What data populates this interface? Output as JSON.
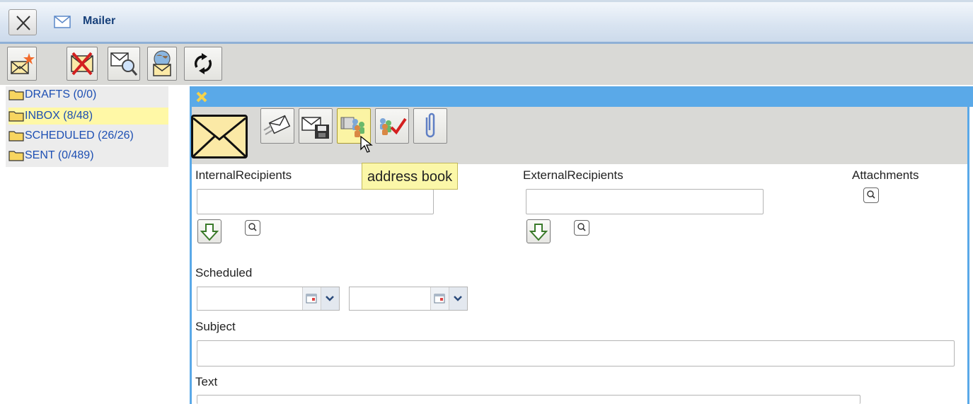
{
  "window": {
    "title": "Mailer",
    "accent_color": "#5aa9e8",
    "close_icon": "close-x-icon",
    "app_icon": "envelope-icon"
  },
  "toolbar": {
    "buttons": [
      {
        "name": "new-mail-button",
        "icon": "new-envelope-star-icon"
      },
      {
        "name": "delete-mail-button",
        "icon": "envelope-red-x-icon"
      },
      {
        "name": "search-mail-button",
        "icon": "envelope-magnifier-icon"
      },
      {
        "name": "web-mail-button",
        "icon": "globe-envelope-icon"
      },
      {
        "name": "refresh-button",
        "icon": "refresh-icon"
      }
    ]
  },
  "folders": [
    {
      "label": "DRAFTS (0/0)",
      "selected": false
    },
    {
      "label": "INBOX (8/48)",
      "selected": true
    },
    {
      "label": "SCHEDULED (26/26)",
      "selected": false
    },
    {
      "label": "SENT (0/489)",
      "selected": false
    }
  ],
  "compose": {
    "header_icon": "close-yellow-x-icon",
    "main_icon": "envelope-icon",
    "toolbar": [
      {
        "name": "send-button",
        "icon": "send-envelope-icon"
      },
      {
        "name": "save-draft-button",
        "icon": "save-envelope-icon"
      },
      {
        "name": "address-book-button",
        "icon": "address-book-icon",
        "hovered": true
      },
      {
        "name": "check-recipients-button",
        "icon": "users-check-icon"
      },
      {
        "name": "attach-button",
        "icon": "paperclip-icon"
      }
    ],
    "tooltip": "address book",
    "internal_recipients": {
      "label": "InternalRecipients",
      "value": ""
    },
    "external_recipients": {
      "label": "ExternalRecipients",
      "value": ""
    },
    "attachments": {
      "label": "Attachments"
    },
    "scheduled": {
      "label": "Scheduled",
      "date_value": "",
      "time_value": ""
    },
    "subject": {
      "label": "Subject",
      "value": ""
    },
    "text": {
      "label": "Text"
    }
  }
}
